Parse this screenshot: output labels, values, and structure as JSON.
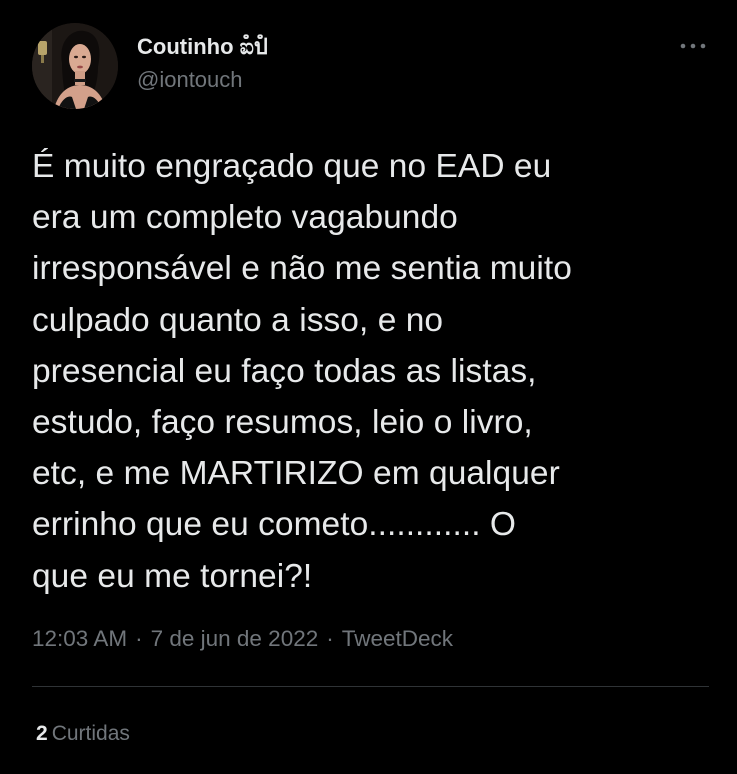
{
  "tweet": {
    "author": {
      "display_name": "Coutinho ಐໍปໍ",
      "handle": "@iontouch"
    },
    "text": "É muito engraçado que no EAD eu\nera um completo vagabundo\nirresponsável e não me sentia muito\nculpado quanto a isso, e no\npresencial eu faço todas as listas,\nestudo, faço resumos, leio o livro,\netc, e me MARTIRIZO em qualquer\nerrinho que eu cometo............ O\nque eu me tornei?!",
    "time": "12:03 AM",
    "date": "7 de jun de 2022",
    "source": "TweetDeck",
    "separator": "·",
    "likes_count": "2",
    "likes_label": "Curtidas"
  },
  "icons": {
    "more": "more-horizontal-icon"
  },
  "colors": {
    "background": "#000000",
    "primary_text": "#e7e9ea",
    "secondary_text": "#71767b",
    "divider": "#2f3336"
  }
}
